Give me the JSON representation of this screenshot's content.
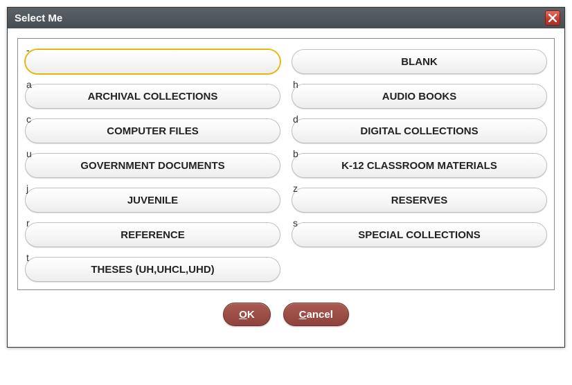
{
  "title": "Select Me",
  "buttons": {
    "ok_prefix": "O",
    "ok_rest": "K",
    "cancel_prefix": "C",
    "cancel_rest": "ancel"
  },
  "options": [
    {
      "key": "-",
      "label": "",
      "selected": true
    },
    {
      "key": "",
      "label": "BLANK",
      "selected": false
    },
    {
      "key": "a",
      "label": "ARCHIVAL COLLECTIONS",
      "selected": false
    },
    {
      "key": "h",
      "label": "AUDIO BOOKS",
      "selected": false
    },
    {
      "key": "c",
      "label": "COMPUTER FILES",
      "selected": false
    },
    {
      "key": "d",
      "label": "DIGITAL COLLECTIONS",
      "selected": false
    },
    {
      "key": "u",
      "label": "GOVERNMENT DOCUMENTS",
      "selected": false
    },
    {
      "key": "b",
      "label": "K-12 CLASSROOM MATERIALS",
      "selected": false
    },
    {
      "key": "j",
      "label": "JUVENILE",
      "selected": false
    },
    {
      "key": "z",
      "label": "RESERVES",
      "selected": false
    },
    {
      "key": "r",
      "label": "REFERENCE",
      "selected": false
    },
    {
      "key": "s",
      "label": "SPECIAL COLLECTIONS",
      "selected": false
    },
    {
      "key": "t",
      "label": "THESES (UH,UHCL,UHD)",
      "selected": false
    }
  ]
}
